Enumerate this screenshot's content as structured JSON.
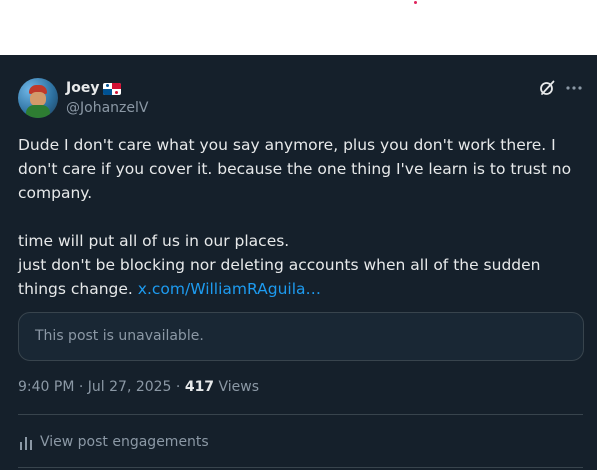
{
  "user": {
    "display_name": "Joey",
    "flag_emoji": "panama-flag",
    "handle": "@JohanzelV"
  },
  "post": {
    "text_lines": [
      "Dude I don't care what you say anymore, plus you don't work there. I",
      "don't care if you cover it. because the one thing I've learn is to trust no",
      "company.",
      "",
      "time will put all of us in our places.",
      "just don't be blocking nor deleting accounts when all of the sudden"
    ],
    "last_line_prefix": "things change. ",
    "link_text": "x.com/WilliamRAguila…",
    "quoted_unavailable": "This post is unavailable."
  },
  "meta": {
    "time": "9:40 PM",
    "sep1": " · ",
    "date": "Jul 27, 2025",
    "sep2": " · ",
    "views_count": "417",
    "views_label": " Views"
  },
  "engagements": {
    "label": "View post engagements"
  },
  "icons": {
    "grok": "grok-icon",
    "more": "more-icon",
    "chart": "bar-chart-icon"
  },
  "colors": {
    "background": "#15202b",
    "link": "#1d9bf0",
    "muted": "#8b98a5",
    "text": "#e7e9ea"
  }
}
